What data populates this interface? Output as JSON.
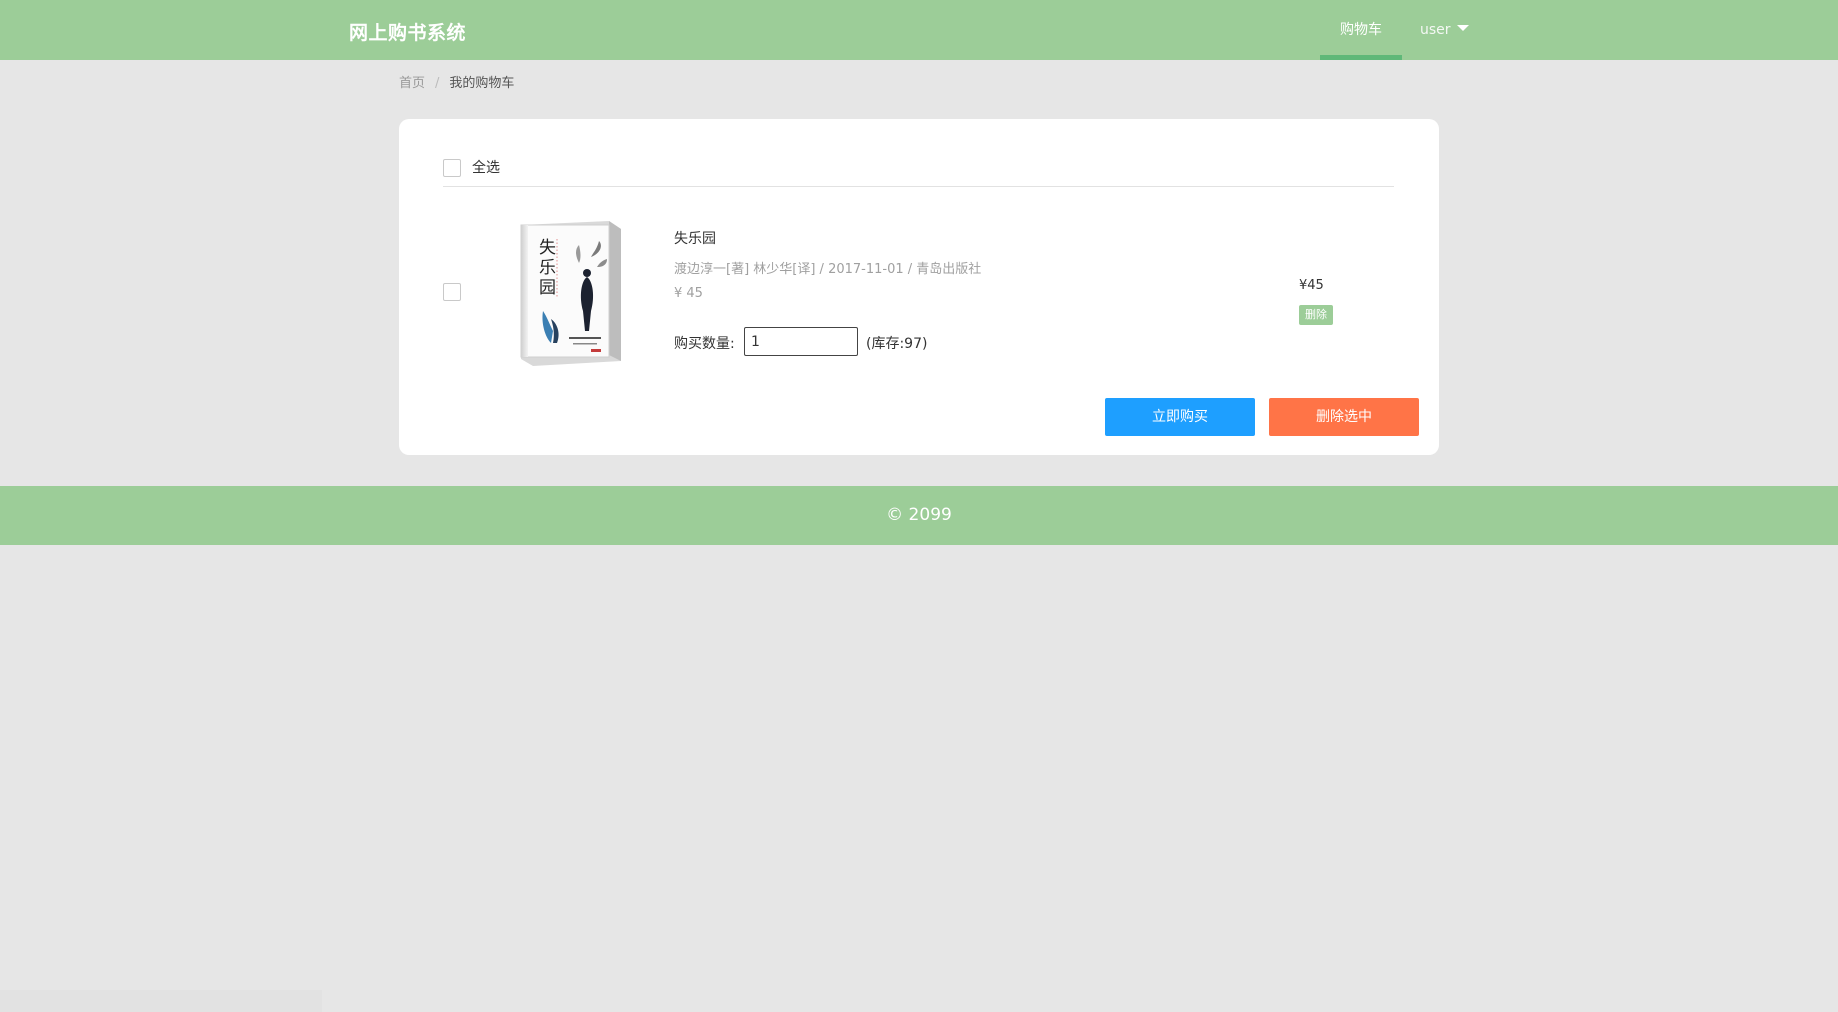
{
  "header": {
    "brand": "网上购书系统",
    "nav_cart": "购物车",
    "nav_user": "user"
  },
  "breadcrumb": {
    "home": "首页",
    "separator": "/",
    "current": "我的购物车"
  },
  "cart": {
    "select_all_label": "全选",
    "items": [
      {
        "cover_title": "失乐园",
        "title": "失乐园",
        "meta": "渡边淳一[著] 林少华[译] / 2017-11-01 / 青岛出版社",
        "price_line": "¥ 45",
        "qty_label": "购买数量:",
        "qty_value": "1",
        "stock": "(库存:97)",
        "row_price": "¥45",
        "delete_label": "删除"
      }
    ],
    "buy_now_label": "立即购买",
    "delete_selected_label": "删除选中"
  },
  "footer": {
    "copyright": "© 2099"
  },
  "colors": {
    "header_green": "#9ccd98",
    "active_bar": "#5fb878",
    "buy_blue": "#1e9fff",
    "delete_orange": "#ff7447",
    "page_bg": "#e6e6e6"
  }
}
